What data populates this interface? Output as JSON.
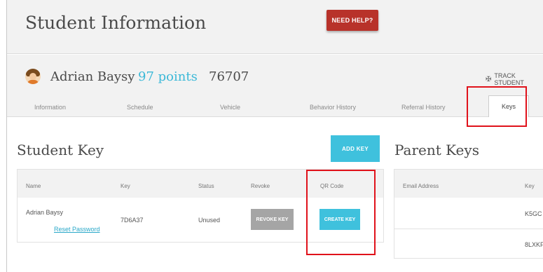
{
  "header": {
    "title": "Student Information",
    "help_label": "NEED HELP?"
  },
  "student": {
    "name": "Adrian Baysy",
    "points": "97 points",
    "id": "76707",
    "track_label": "TRACK STUDENT"
  },
  "tabs": [
    {
      "label": "Information"
    },
    {
      "label": "Schedule"
    },
    {
      "label": "Vehicle"
    },
    {
      "label": "Behavior History"
    },
    {
      "label": "Referral History"
    },
    {
      "label": "Keys",
      "active": true
    }
  ],
  "student_key": {
    "title": "Student Key",
    "add_label": "ADD KEY",
    "columns": [
      "Name",
      "Key",
      "Status",
      "Revoke",
      "QR Code"
    ],
    "row": {
      "name": "Adrian Baysy",
      "reset_label": "Reset Password",
      "key": "7D6A37",
      "status": "Unused",
      "revoke_label": "REVOKE KEY",
      "create_label": "CREATE KEY"
    }
  },
  "parent_keys": {
    "title": "Parent Keys",
    "columns": [
      "Email Address",
      "Key"
    ],
    "rows": [
      {
        "email": "",
        "key": "K5GC"
      },
      {
        "email": "",
        "key": "8LXKF"
      }
    ]
  },
  "colors": {
    "accent": "#3fc1dd",
    "help": "#b8322a",
    "highlight": "#e0121b",
    "revoke": "#a5a5a5"
  }
}
